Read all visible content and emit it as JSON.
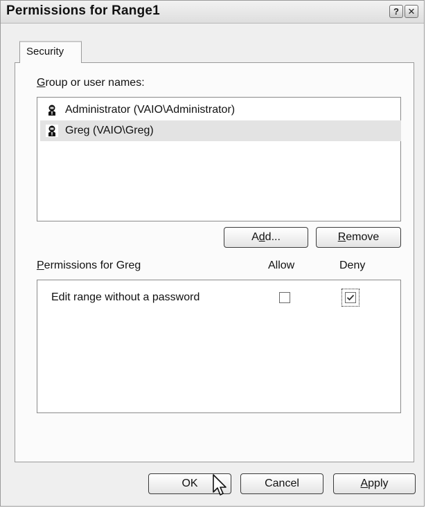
{
  "window": {
    "title": "Permissions for Range1",
    "help_glyph": "?",
    "close_glyph": "✕"
  },
  "tabs": [
    {
      "label": "Security",
      "active": true
    }
  ],
  "group_section": {
    "label_mnemonic": "G",
    "label_rest": "roup or user names:",
    "users": [
      {
        "name": "Administrator (VAIO\\Administrator)",
        "icon": "user-icon",
        "selected": false
      },
      {
        "name": "Greg (VAIO\\Greg)",
        "icon": "user-icon",
        "selected": true
      }
    ],
    "add_button": {
      "pre": "A",
      "mnemonic": "d",
      "post": "d..."
    },
    "remove_button": {
      "pre": "",
      "mnemonic": "R",
      "post": "emove"
    }
  },
  "permissions_section": {
    "label_mnemonic": "P",
    "label_rest": "ermissions for Greg",
    "allow_header": "Allow",
    "deny_header": "Deny",
    "rows": [
      {
        "name": "Edit range without a password",
        "allow": false,
        "deny": true
      }
    ]
  },
  "footer": {
    "ok_label": "OK",
    "cancel_label": "Cancel",
    "apply_button": {
      "pre": "",
      "mnemonic": "A",
      "post": "pply"
    }
  },
  "colors": {
    "dialog_bg": "#efefef",
    "panel_bg": "#fbfbfb",
    "selection_bg": "#e3e3e3",
    "border": "#9a9a9a"
  }
}
